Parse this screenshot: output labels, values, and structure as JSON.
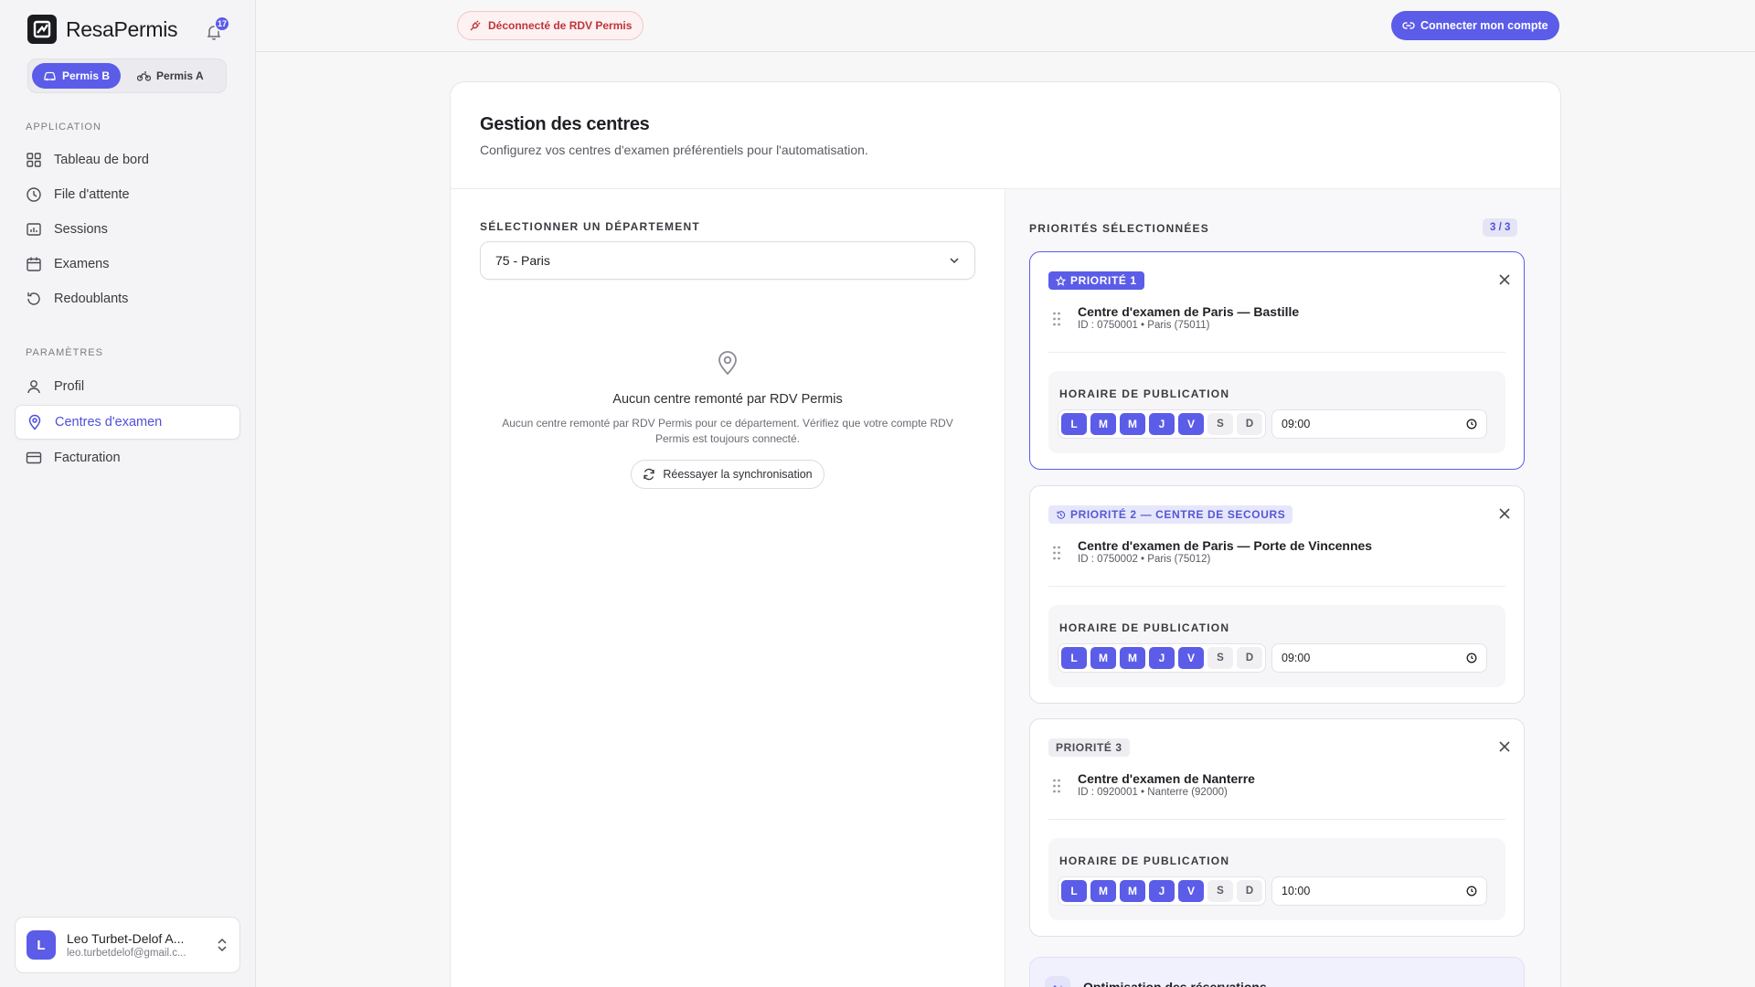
{
  "app": {
    "name": "ResaPermis",
    "notifications": "17"
  },
  "permis": {
    "b_label": "Permis B",
    "a_label": "Permis A"
  },
  "sidebar": {
    "section_app": "APPLICATION",
    "section_params": "PARAMÈTRES",
    "items": [
      {
        "label": "Tableau de bord"
      },
      {
        "label": "File d'attente"
      },
      {
        "label": "Sessions"
      },
      {
        "label": "Examens"
      },
      {
        "label": "Redoublants"
      },
      {
        "label": "Profil"
      },
      {
        "label": "Centres d'examen"
      },
      {
        "label": "Facturation"
      }
    ]
  },
  "user": {
    "initial": "L",
    "name": "Leo Turbet-Delof A...",
    "email": "leo.turbetdelof@gmail.c..."
  },
  "topbar": {
    "status": "Déconnecté de RDV Permis",
    "connect": "Connecter mon compte"
  },
  "page": {
    "title": "Gestion des centres",
    "subtitle": "Configurez vos centres d'examen préférentiels pour l'automatisation."
  },
  "department": {
    "label": "SÉLECTIONNER UN DÉPARTEMENT",
    "value": "75 - Paris",
    "empty_title": "Aucun centre remonté par RDV Permis",
    "empty_desc": "Aucun centre remonté par RDV Permis pour ce département. Vérifiez que votre compte RDV Permis est toujours connecté.",
    "retry": "Réessayer la synchronisation"
  },
  "priorities": {
    "label": "PRIORITÉS SÉLECTIONNÉES",
    "count": "3 / 3",
    "schedule_label": "HORAIRE DE PUBLICATION",
    "days": [
      "L",
      "M",
      "M",
      "J",
      "V",
      "S",
      "D"
    ],
    "items": [
      {
        "badge": "PRIORITÉ 1",
        "name": "Centre d'examen de Paris — Bastille",
        "meta": "ID : 0750001 • Paris (75011)",
        "time": "09:00"
      },
      {
        "badge": "PRIORITÉ 2 — CENTRE DE SECOURS",
        "name": "Centre d'examen de Paris — Porte de Vincennes",
        "meta": "ID : 0750002 • Paris (75012)",
        "time": "09:00"
      },
      {
        "badge": "PRIORITÉ 3",
        "name": "Centre d'examen de Nanterre",
        "meta": "ID : 0920001 • Nanterre (92000)",
        "time": "10:00"
      }
    ]
  },
  "optimisation": {
    "icon_text": "A⁺",
    "title": "Optimisation des réservations"
  },
  "colors": {
    "accent": "#5b5ce8",
    "danger": "#c0343a"
  }
}
